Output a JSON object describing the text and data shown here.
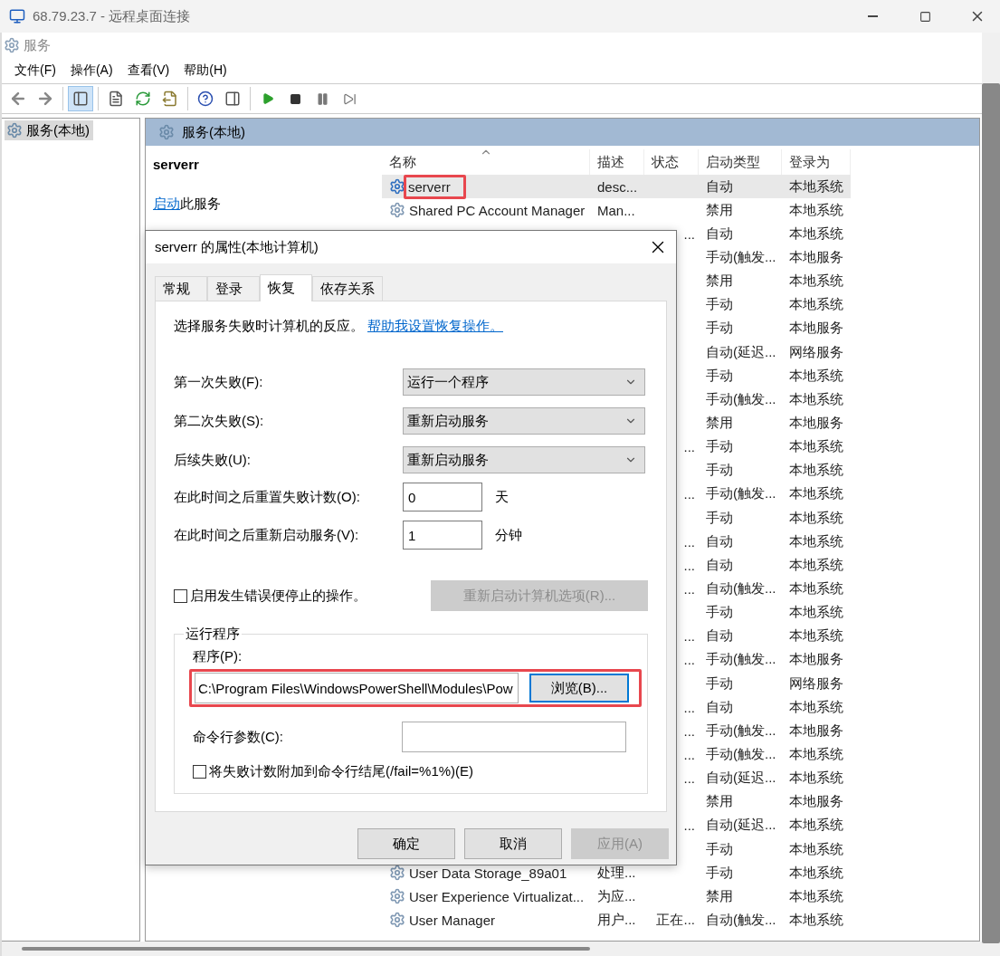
{
  "remote_window": {
    "title": "68.79.23.7 - 远程桌面连接"
  },
  "app_title": "服务",
  "menu": [
    "文件(F)",
    "操作(A)",
    "查看(V)",
    "帮助(H)"
  ],
  "toolbar": [
    {
      "kind": "back",
      "disabled": true
    },
    {
      "kind": "forward",
      "disabled": true
    },
    {
      "kind": "sep"
    },
    {
      "kind": "tree",
      "pressed": true
    },
    {
      "kind": "sep"
    },
    {
      "kind": "properties"
    },
    {
      "kind": "refresh"
    },
    {
      "kind": "export"
    },
    {
      "kind": "sep"
    },
    {
      "kind": "help"
    },
    {
      "kind": "panel"
    },
    {
      "kind": "sep"
    },
    {
      "kind": "start"
    },
    {
      "kind": "stop"
    },
    {
      "kind": "pause"
    },
    {
      "kind": "resume"
    }
  ],
  "tree": {
    "items": [
      {
        "label": "服务(本地)",
        "selected": true
      }
    ]
  },
  "panel": {
    "title": "服务(本地)",
    "service_name": "serverr",
    "action_link": "启动",
    "action_text": "此服务"
  },
  "table": {
    "columns": [
      {
        "label": "名称",
        "sorted": true
      },
      {
        "label": "描述",
        "sorted": false
      },
      {
        "label": "状态",
        "sorted": false
      },
      {
        "label": "启动类型",
        "sorted": false
      },
      {
        "label": "登录为",
        "sorted": false
      }
    ],
    "rows": [
      {
        "name": "serverr",
        "description": "desc...",
        "status": "",
        "startup": "自动",
        "logon": "本地系统",
        "selected": true,
        "highlighted": true
      },
      {
        "name": "Shared PC Account Manager",
        "description": "Man...",
        "status": "",
        "startup": "禁用",
        "logon": "本地系统",
        "selected": false,
        "highlighted": false
      },
      {
        "name": "",
        "description": "",
        "status": "...",
        "startup": "自动",
        "logon": "本地系统",
        "selected": false
      },
      {
        "name": "",
        "description": "",
        "status": "",
        "startup": "手动(触发...",
        "logon": "本地服务",
        "selected": false
      },
      {
        "name": "",
        "description": "",
        "status": "",
        "startup": "禁用",
        "logon": "本地系统",
        "selected": false
      },
      {
        "name": "",
        "description": "",
        "status": "",
        "startup": "手动",
        "logon": "本地系统",
        "selected": false
      },
      {
        "name": "",
        "description": "",
        "status": "",
        "startup": "手动",
        "logon": "本地服务",
        "selected": false
      },
      {
        "name": "",
        "description": "",
        "status": "",
        "startup": "自动(延迟...",
        "logon": "网络服务",
        "selected": false
      },
      {
        "name": "",
        "description": "",
        "status": "",
        "startup": "手动",
        "logon": "本地系统",
        "selected": false
      },
      {
        "name": "",
        "description": "",
        "status": "",
        "startup": "手动(触发...",
        "logon": "本地系统",
        "selected": false
      },
      {
        "name": "",
        "description": "",
        "status": "",
        "startup": "禁用",
        "logon": "本地服务",
        "selected": false
      },
      {
        "name": "",
        "description": "",
        "status": "...",
        "startup": "手动",
        "logon": "本地系统",
        "selected": false
      },
      {
        "name": "",
        "description": "",
        "status": "",
        "startup": "手动",
        "logon": "本地系统",
        "selected": false
      },
      {
        "name": "",
        "description": "",
        "status": "...",
        "startup": "手动(触发...",
        "logon": "本地系统",
        "selected": false
      },
      {
        "name": "",
        "description": "",
        "status": "",
        "startup": "手动",
        "logon": "本地系统",
        "selected": false
      },
      {
        "name": "",
        "description": "",
        "status": "...",
        "startup": "自动",
        "logon": "本地系统",
        "selected": false
      },
      {
        "name": "",
        "description": "",
        "status": "...",
        "startup": "自动",
        "logon": "本地系统",
        "selected": false
      },
      {
        "name": "",
        "description": "",
        "status": "...",
        "startup": "自动(触发...",
        "logon": "本地系统",
        "selected": false
      },
      {
        "name": "",
        "description": "",
        "status": "",
        "startup": "手动",
        "logon": "本地系统",
        "selected": false
      },
      {
        "name": "",
        "description": "",
        "status": "...",
        "startup": "自动",
        "logon": "本地系统",
        "selected": false
      },
      {
        "name": "",
        "description": "",
        "status": "...",
        "startup": "手动(触发...",
        "logon": "本地服务",
        "selected": false
      },
      {
        "name": "",
        "description": "",
        "status": "",
        "startup": "手动",
        "logon": "网络服务",
        "selected": false
      },
      {
        "name": "",
        "description": "",
        "status": "...",
        "startup": "自动",
        "logon": "本地系统",
        "selected": false
      },
      {
        "name": "",
        "description": "",
        "status": "...",
        "startup": "手动(触发...",
        "logon": "本地服务",
        "selected": false
      },
      {
        "name": "",
        "description": "",
        "status": "...",
        "startup": "手动(触发...",
        "logon": "本地系统",
        "selected": false
      },
      {
        "name": "",
        "description": "",
        "status": "...",
        "startup": "自动(延迟...",
        "logon": "本地系统",
        "selected": false
      },
      {
        "name": "",
        "description": "",
        "status": "",
        "startup": "禁用",
        "logon": "本地服务",
        "selected": false
      },
      {
        "name": "",
        "description": "",
        "status": "...",
        "startup": "自动(延迟...",
        "logon": "本地系统",
        "selected": false
      },
      {
        "name": "",
        "description": "",
        "status": "",
        "startup": "手动",
        "logon": "本地系统",
        "selected": false
      },
      {
        "name": "User Data Storage_89a01",
        "description": "处理...",
        "status": "",
        "startup": "手动",
        "logon": "本地系统",
        "selected": false,
        "highlighted": false
      },
      {
        "name": "User Experience Virtualizat...",
        "description": "为应...",
        "status": "",
        "startup": "禁用",
        "logon": "本地系统",
        "selected": false,
        "highlighted": false
      },
      {
        "name": "User Manager",
        "description": "用户...",
        "status": "正在...",
        "startup": "自动(触发...",
        "logon": "本地系统",
        "selected": false,
        "highlighted": false
      }
    ]
  },
  "dialog": {
    "title": "serverr 的属性(本地计算机)",
    "tabs": [
      {
        "label": "常规",
        "selected": false
      },
      {
        "label": "登录",
        "selected": false
      },
      {
        "label": "恢复",
        "selected": true
      },
      {
        "label": "依存关系",
        "selected": false
      }
    ],
    "intro": "选择服务失败时计算机的反应。",
    "help_link": "帮助我设置恢复操作。",
    "failures": [
      {
        "label": "第一次失败(F):",
        "value": "运行一个程序"
      },
      {
        "label": "第二次失败(S):",
        "value": "重新启动服务"
      },
      {
        "label": "后续失败(U):",
        "value": "重新启动服务"
      }
    ],
    "counters": [
      {
        "label": "在此时间之后重置失败计数(O):",
        "value": "0",
        "unit": "天"
      },
      {
        "label": "在此时间之后重新启动服务(V):",
        "value": "1",
        "unit": "分钟"
      }
    ],
    "enable_stop": {
      "label": "启用发生错误便停止的操作。",
      "checked": false
    },
    "restart_options_button": {
      "label": "重新启动计算机选项(R)...",
      "disabled": true
    },
    "run_program": {
      "legend": "运行程序",
      "program_label": "程序(P):",
      "program_value": "C:\\Program Files\\WindowsPowerShell\\Modules\\Pow",
      "highlighted": true,
      "browse_label": "浏览(B)...",
      "args_label": "命令行参数(C):",
      "append_fail": {
        "label": "将失败计数附加到命令行结尾(/fail=%1%)(E)",
        "checked": false
      }
    },
    "buttons": [
      {
        "label": "确定",
        "disabled": false
      },
      {
        "label": "取消",
        "disabled": false
      },
      {
        "label": "应用(A)",
        "disabled": true
      }
    ]
  }
}
